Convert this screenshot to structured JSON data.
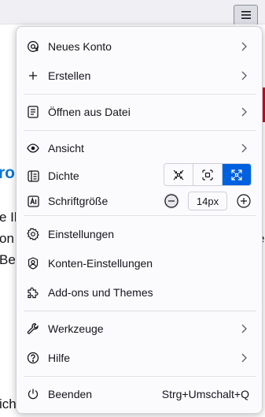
{
  "background": {
    "heading_fragment": "ro",
    "line_fragments_left": [
      "e Ih",
      "on",
      "Be",
      "ich"
    ],
    "line_fragment_right": "e"
  },
  "menu": {
    "items": {
      "new_account": "Neues Konto",
      "create": "Erstellen",
      "open_file": "Öffnen aus Datei",
      "view": "Ansicht",
      "density": "Dichte",
      "font_size": "Schriftgröße",
      "settings": "Einstellungen",
      "account_settings": "Konten-Einstellungen",
      "addons": "Add-ons und Themes",
      "tools": "Werkzeuge",
      "help": "Hilfe",
      "quit": "Beenden"
    },
    "quit_shortcut": "Strg+Umschalt+Q",
    "font_size_value": "14px",
    "density_options": [
      "compact",
      "normal",
      "touch"
    ],
    "density_selected": "touch",
    "accent_color": "#0061e0"
  }
}
